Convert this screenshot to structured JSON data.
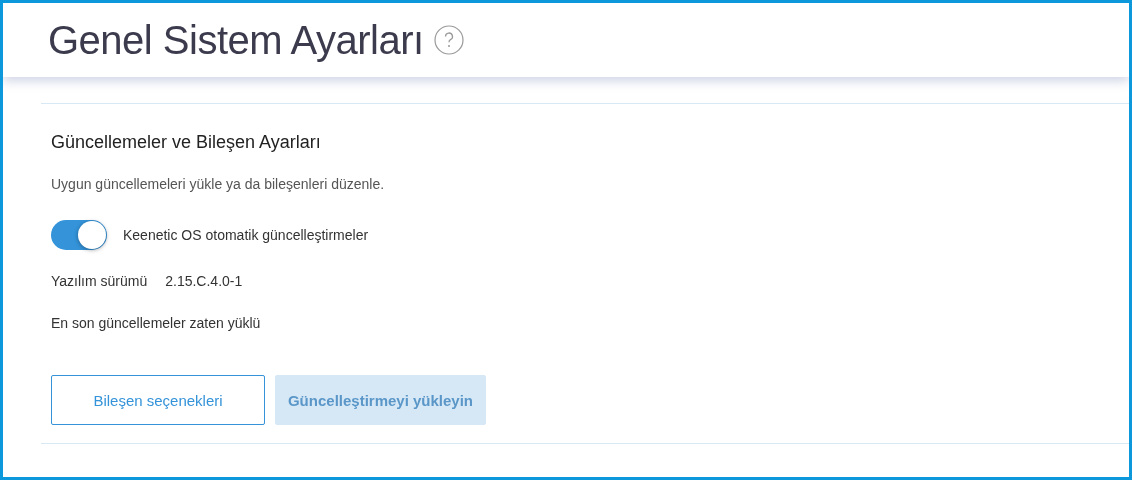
{
  "page": {
    "title": "Genel Sistem Ayarları"
  },
  "section": {
    "title": "Güncellemeler ve Bileşen Ayarları",
    "description": "Uygun güncellemeleri yükle ya da bileşenleri düzenle.",
    "auto_update": {
      "label": "Keenetic OS otomatik güncelleştirmeler",
      "on": true
    },
    "firmware": {
      "label": "Yazılım sürümü",
      "value": "2.15.C.4.0-1"
    },
    "status": "En son güncellemeler zaten yüklü",
    "buttons": [
      {
        "label": "Bileşen seçenekleri",
        "disabled": false
      },
      {
        "label": "Güncelleştirmeyi yükleyin",
        "disabled": true
      }
    ]
  }
}
